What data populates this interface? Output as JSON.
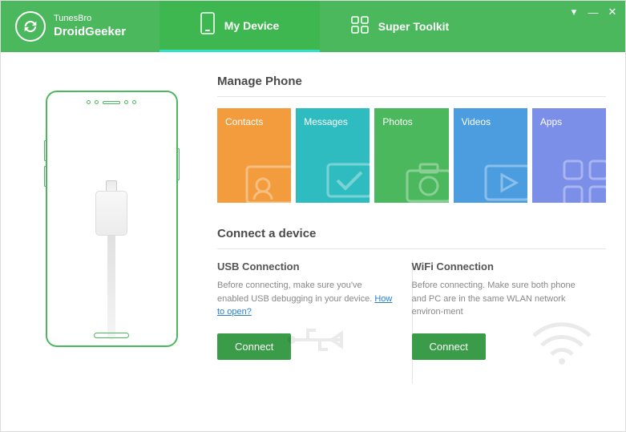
{
  "brand": {
    "small": "TunesBro",
    "big": "DroidGeeker"
  },
  "tabs": {
    "mydevice": "My Device",
    "toolkit": "Super Toolkit"
  },
  "manage": {
    "title": "Manage Phone",
    "tiles": {
      "contacts": "Contacts",
      "messages": "Messages",
      "photos": "Photos",
      "videos": "Videos",
      "apps": "Apps"
    }
  },
  "connect": {
    "title": "Connect a device",
    "usb": {
      "title": "USB Connection",
      "desc_prefix": "Before connecting, make sure you've enabled USB debugging in your device. ",
      "link": "How to open?",
      "btn": "Connect"
    },
    "wifi": {
      "title": "WiFi Connection",
      "desc": "Before connecting. Make sure both phone and PC are in the same WLAN network environ-ment",
      "btn": "Connect"
    }
  },
  "colors": {
    "primary": "#4cb85d",
    "contacts": "#f39c3e",
    "messages": "#2fbcc0",
    "photos": "#4cb85d",
    "videos": "#4b9de0",
    "apps": "#7b8ee8"
  }
}
